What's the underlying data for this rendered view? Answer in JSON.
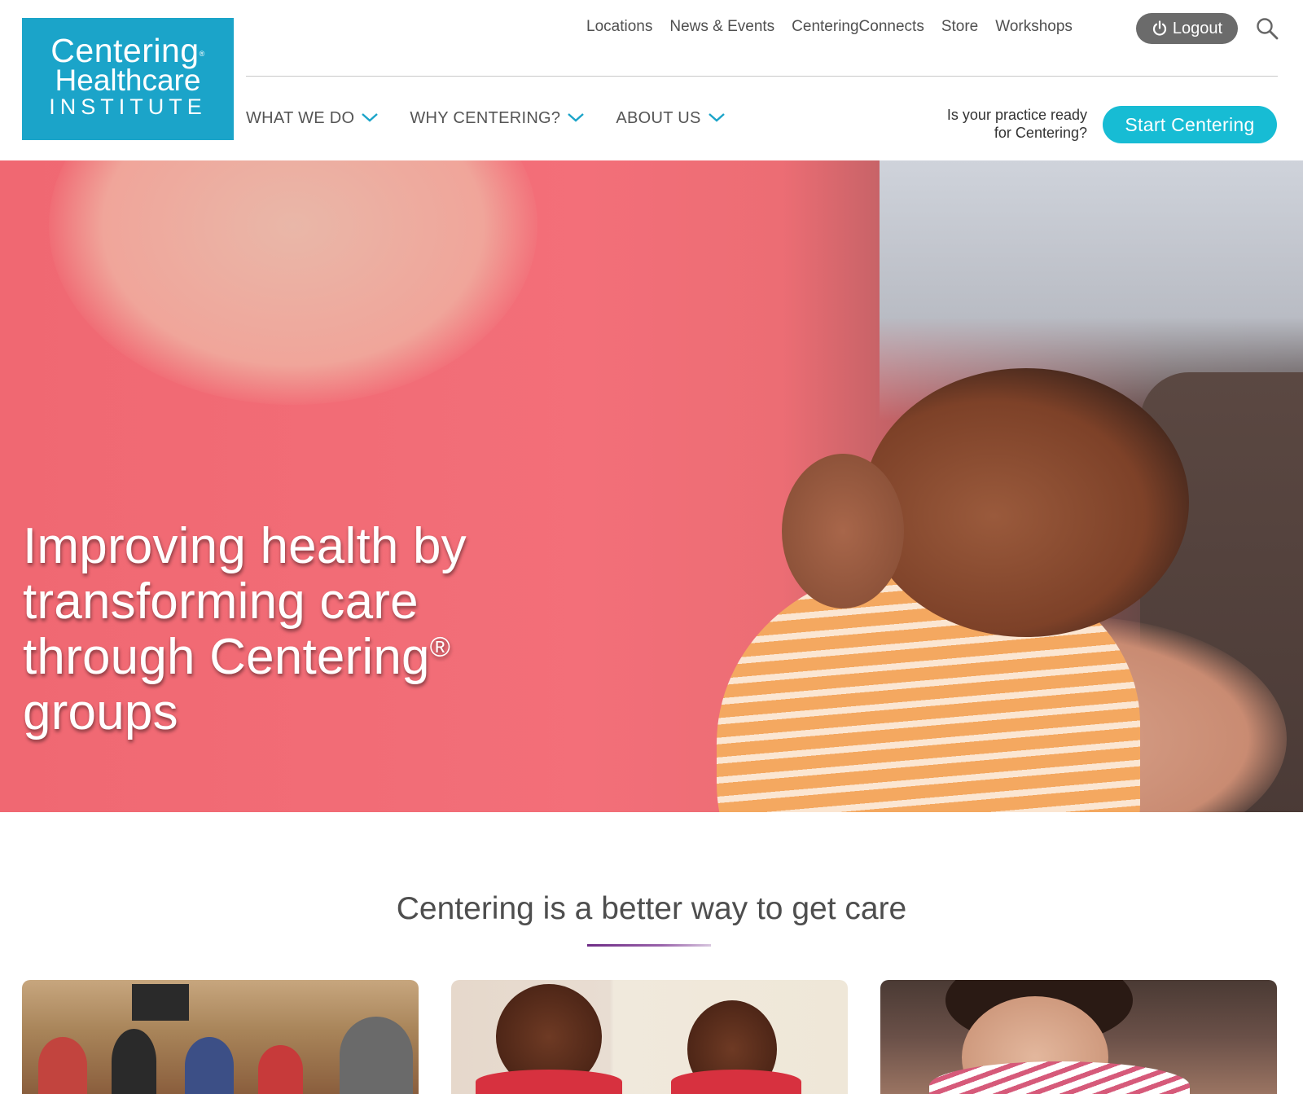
{
  "logo": {
    "line1": "Centering",
    "registered": "®",
    "line2": "Healthcare",
    "line3": "INSTITUTE",
    "color": "#1ba4c9"
  },
  "utility_nav": {
    "items": [
      {
        "label": "Locations"
      },
      {
        "label": "News & Events"
      },
      {
        "label": "CenteringConnects"
      },
      {
        "label": "Store"
      },
      {
        "label": "Workshops"
      }
    ],
    "logout_label": "Logout",
    "logout_icon": "power-icon",
    "search_icon": "search-icon"
  },
  "main_nav": {
    "items": [
      {
        "label": "WHAT WE DO",
        "icon": "chevron-down-icon"
      },
      {
        "label": "WHY CENTERING?",
        "icon": "chevron-down-icon"
      },
      {
        "label": "ABOUT US",
        "icon": "chevron-down-icon"
      }
    ],
    "ready_prompt_line1": "Is your practice ready",
    "ready_prompt_line2": "for Centering?",
    "cta_label": "Start Centering",
    "cta_color": "#17bcd4",
    "accent_color": "#1ba4c9"
  },
  "hero": {
    "headline_line1": "Improving health by",
    "headline_line2": "transforming care",
    "headline_line3": "through Centering",
    "headline_sup": "®",
    "headline_line4": "groups"
  },
  "section": {
    "title": "Centering is a better way to get care",
    "underline_color": "#6e2c86"
  }
}
